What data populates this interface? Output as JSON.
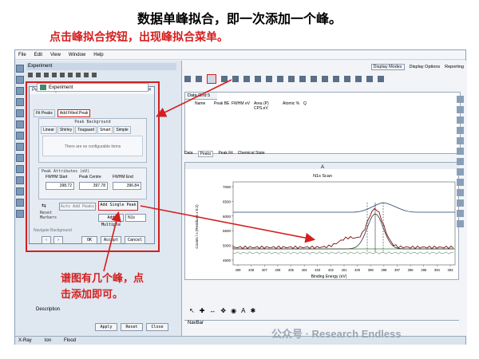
{
  "annotations": {
    "heading": "数据单峰拟合，即一次添加一个峰。",
    "subheading": "点击峰拟合按钮，出现峰拟合菜单。",
    "note_line1": "谱图有几个峰，点",
    "note_line2": "击添加即可。"
  },
  "menu": [
    "File",
    "Edit",
    "View",
    "Window",
    "Help"
  ],
  "experiment_panel": {
    "title": "Experiment"
  },
  "dialog": {
    "title": "Peak Fitting",
    "tabs": [
      "Fit Peaks",
      "Add Fitted Peak"
    ],
    "background_group": {
      "label": "Peak Background",
      "options": [
        "Linear",
        "Shirley",
        "Tougaard",
        "Smart",
        "Simple"
      ],
      "message": "There are no configurable items"
    },
    "attributes": {
      "label": "Peak Attributes (eV)",
      "headers": [
        "FWHM Start",
        "Peak Centre",
        "FWHM End"
      ],
      "values": [
        "398.72",
        "397.78",
        "396.84"
      ]
    },
    "buttons": {
      "auto_add": "Auto Add Peaks",
      "add_single": "Add Single Peak",
      "add_multi": "Add Multiple",
      "multi_value": "N1s",
      "ok": "OK",
      "accept": "Accept",
      "cancel": "Cancel"
    },
    "reset_label": "Reset Markers",
    "navigate_label": "Navigate Background"
  },
  "panel_under": {
    "description_label": "Description",
    "buttons": [
      "Apply",
      "Reset",
      "Close"
    ]
  },
  "right_toolbar": {
    "items": [
      "Display Modes",
      "Display Options",
      "Reporting"
    ]
  },
  "grid": {
    "tab": "Data Grid 5",
    "headers": [
      "Name",
      "Peak BE",
      "FWHM eV",
      "Area (P) CPS.eV",
      "Atomic %",
      "Q"
    ]
  },
  "subtabs": [
    "Data",
    "Peaks",
    "Peak Fit",
    "Chemical State"
  ],
  "plot": {
    "tab": "A",
    "title": "N1s Scan",
    "ylabel": "Counts / s (Residuals x 0.2)",
    "xlabel": "Binding Energy (eV)",
    "yticks": [
      "7000",
      "6500",
      "6000",
      "5500",
      "5000",
      "4500"
    ],
    "xticks": [
      "409",
      "408",
      "407",
      "406",
      "405",
      "404",
      "403",
      "402",
      "401",
      "400",
      "399",
      "398",
      "397",
      "396",
      "395",
      "394",
      "393"
    ],
    "colors": {
      "spectrum": "#7a1010",
      "envelope": "#1f3f7a",
      "background": "#2e7d32",
      "residual": "#6b8f71"
    }
  },
  "navbar_label": "NavBar",
  "status": [
    "X-Ray",
    "Ion",
    "Flood"
  ],
  "watermark": "公众号 · Research Endless"
}
